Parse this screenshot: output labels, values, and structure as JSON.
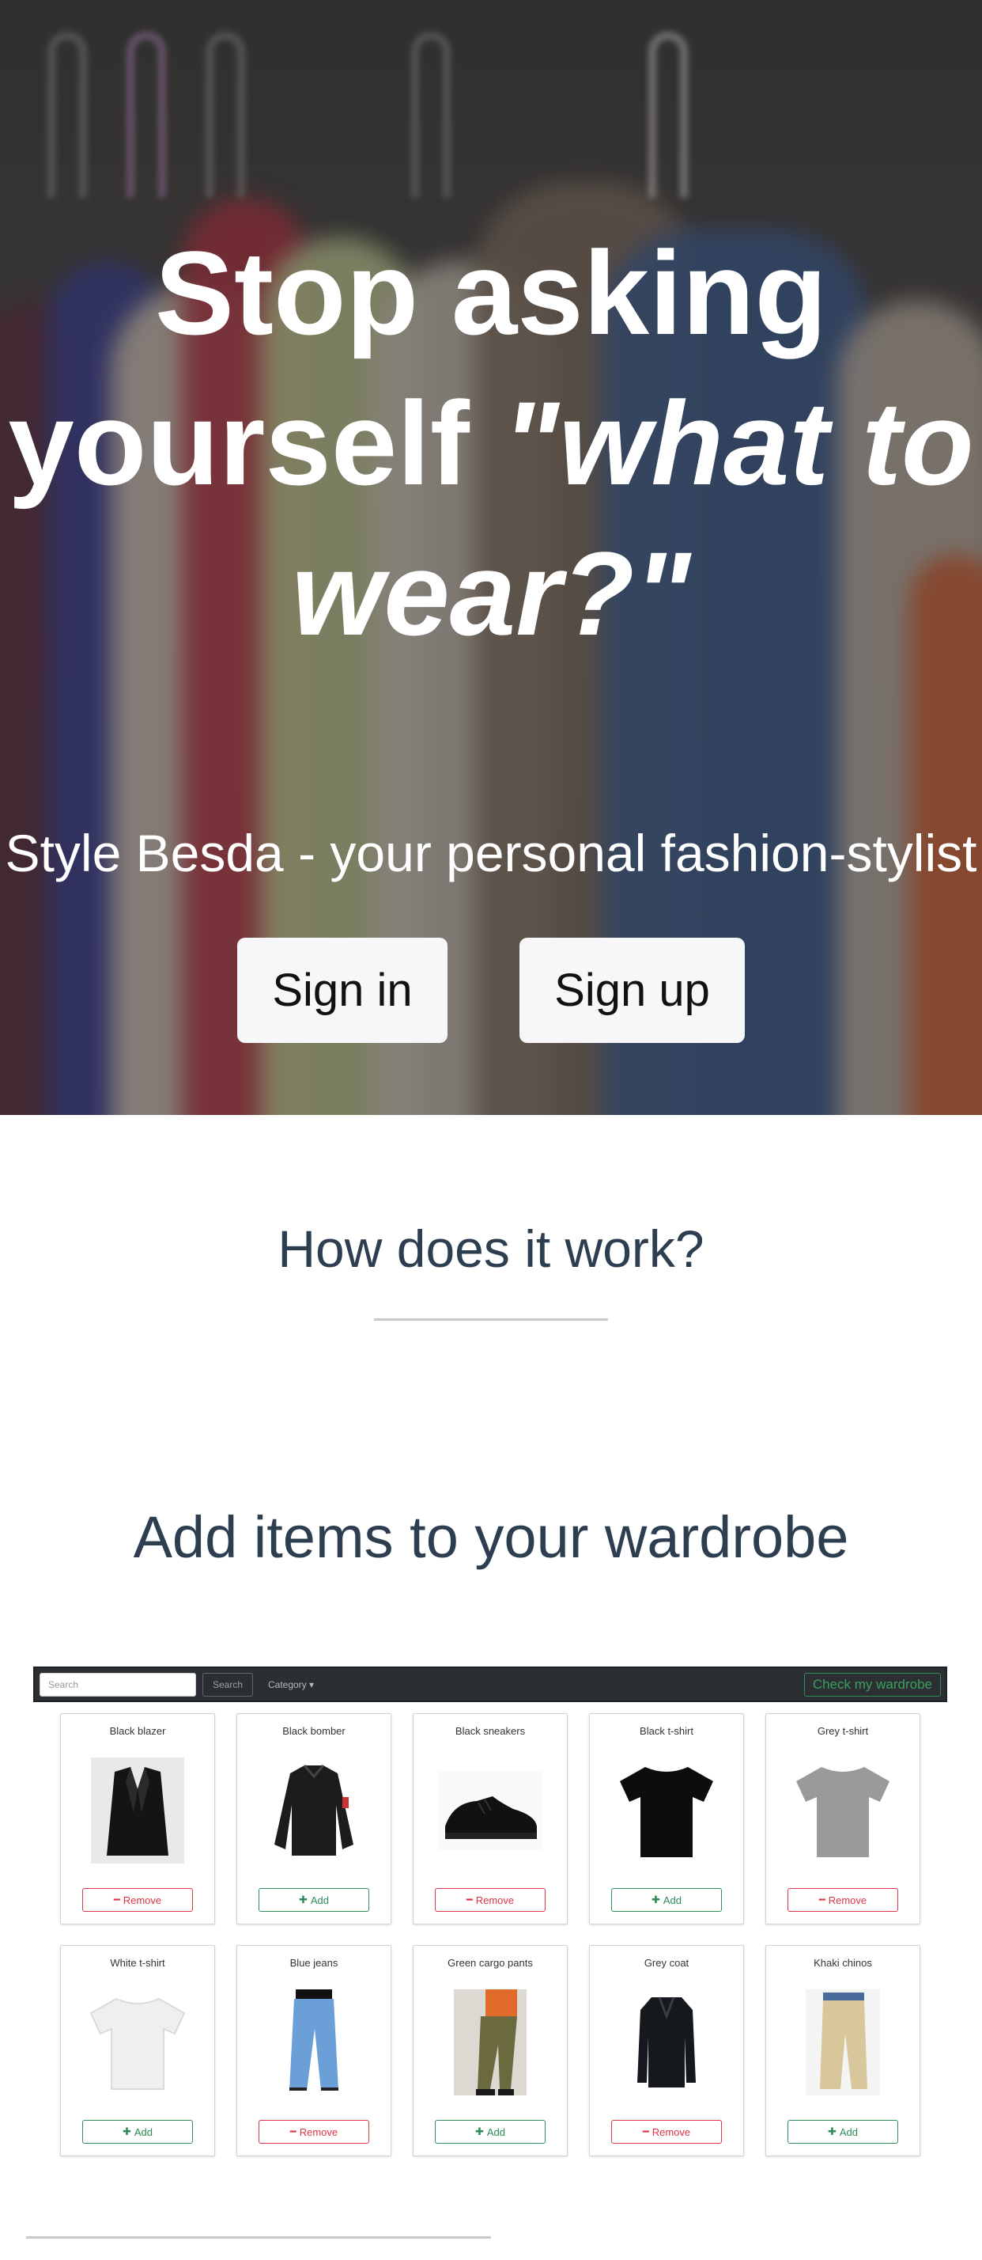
{
  "hero": {
    "title_plain": "Stop asking yourself ",
    "title_italic": "\"what to wear?\"",
    "subtitle": "Style Besda - your personal fashion-stylist",
    "signin_label": "Sign in",
    "signup_label": "Sign up"
  },
  "how": {
    "title": "How does it work?"
  },
  "wardrobe": {
    "title": "Add items to your wardrobe",
    "search_placeholder": "Search",
    "search_button": "Search",
    "category_label": "Category",
    "check_button": "Check my wardrobe",
    "add_label": "Add",
    "remove_label": "Remove",
    "items": [
      {
        "name": "Black blazer",
        "action": "remove"
      },
      {
        "name": "Black bomber",
        "action": "add"
      },
      {
        "name": "Black sneakers",
        "action": "remove"
      },
      {
        "name": "Black t-shirt",
        "action": "add"
      },
      {
        "name": "Grey t-shirt",
        "action": "remove"
      },
      {
        "name": "White t-shirt",
        "action": "add"
      },
      {
        "name": "Blue jeans",
        "action": "remove"
      },
      {
        "name": "Green cargo pants",
        "action": "add"
      },
      {
        "name": "Grey coat",
        "action": "remove"
      },
      {
        "name": "Khaki chinos",
        "action": "add"
      }
    ]
  },
  "colors": {
    "heading": "#2c3e50",
    "add": "#2e8b57",
    "remove": "#dc3545"
  }
}
